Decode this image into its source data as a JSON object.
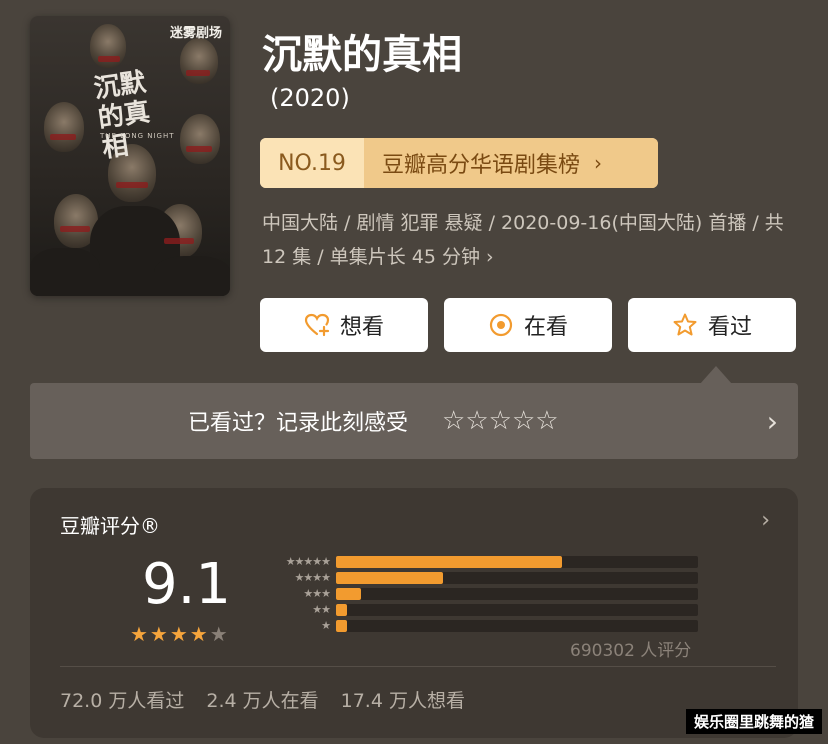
{
  "poster": {
    "logo": "迷雾剧场",
    "title": "沉默的真相",
    "subtitle": "THE LONG NIGHT"
  },
  "header": {
    "title": "沉默的真相",
    "year": "(2020)"
  },
  "rank": {
    "number": "NO.19",
    "list_name": "豆瓣高分华语剧集榜",
    "arrow": "›"
  },
  "meta": {
    "text": "中国大陆 / 剧情 犯罪 悬疑 / 2020-09-16(中国大陆) 首播 / 共 12 集 / 单集片长 45 分钟",
    "arrow": "›"
  },
  "actions": {
    "want": "想看",
    "watching": "在看",
    "watched": "看过"
  },
  "record": {
    "prompt": "已看过？记录此刻感受",
    "stars": "☆☆☆☆☆",
    "arrow": "›"
  },
  "rating": {
    "title": "豆瓣评分®",
    "arrow": "›",
    "score": "9.1",
    "stars": "★★★★",
    "half_star": "★",
    "histogram": [
      {
        "label": "★★★★★",
        "fraction": 0.625
      },
      {
        "label": "★★★★",
        "fraction": 0.295
      },
      {
        "label": "★★★",
        "fraction": 0.07
      },
      {
        "label": "★★",
        "fraction": 0.03
      },
      {
        "label": "★",
        "fraction": 0.03
      }
    ],
    "count": "690302 人评分"
  },
  "stats": {
    "watched": "72.0 万人看过",
    "watching": "2.4 万人在看",
    "want": "17.4 万人想看"
  },
  "watermark": "娱乐圈里跳舞的猹",
  "colors": {
    "bar": "#f29b2f",
    "star": "#f6a53c",
    "rank_bg": "#f0c98a"
  }
}
